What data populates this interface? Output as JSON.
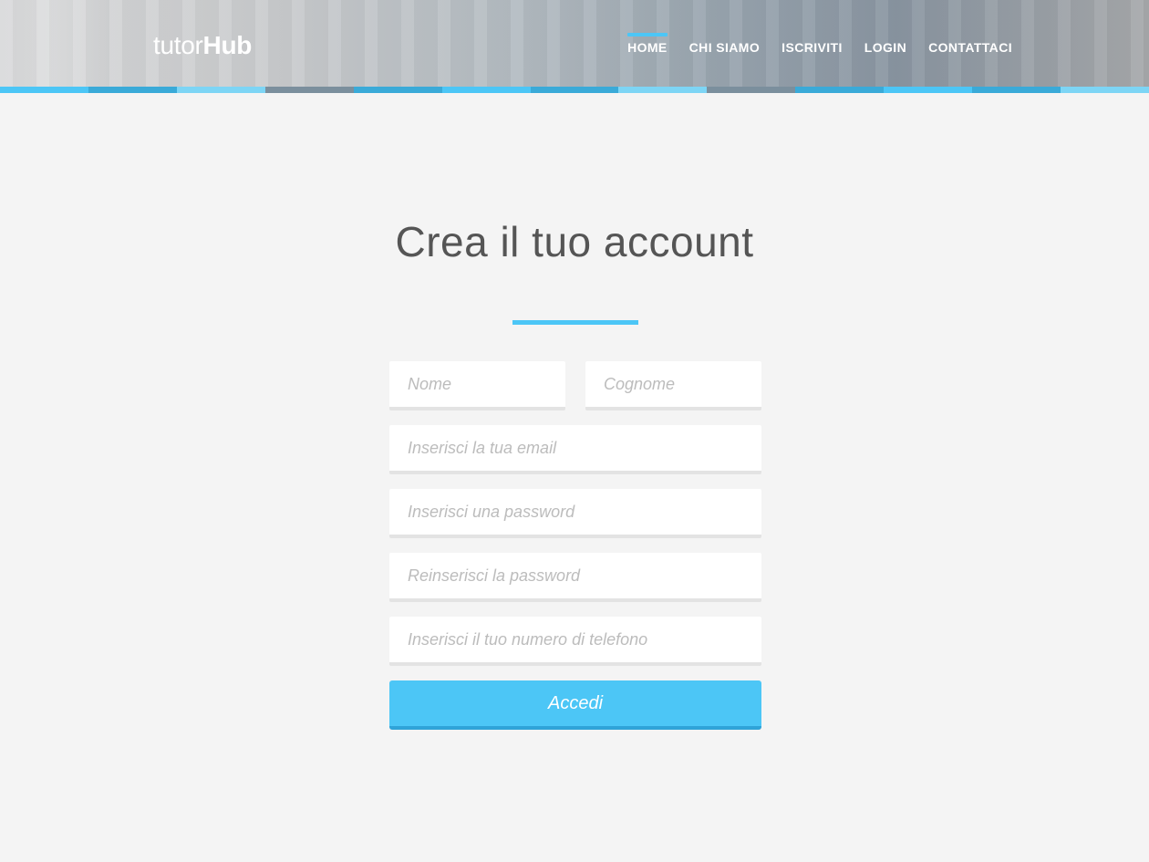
{
  "header": {
    "logo_light": "tutor",
    "logo_bold": "Hub",
    "nav": [
      {
        "label": "HOME",
        "active": true
      },
      {
        "label": "CHI SIAMO",
        "active": false
      },
      {
        "label": "ISCRIVITI",
        "active": false
      },
      {
        "label": "LOGIN",
        "active": false
      },
      {
        "label": "CONTATTACI",
        "active": false
      }
    ],
    "stripe_colors": [
      "#4cc6f6",
      "#3aaad8",
      "#7dd5f5",
      "#7b8f9d",
      "#3aaad8",
      "#4cc6f6",
      "#3aaad8",
      "#7dd5f5",
      "#7b8f9d",
      "#3aaad8",
      "#4cc6f6",
      "#3aaad8",
      "#7dd5f5"
    ]
  },
  "main": {
    "title": "Crea il tuo account"
  },
  "form": {
    "first_name_placeholder": "Nome",
    "last_name_placeholder": "Cognome",
    "email_placeholder": "Inserisci la tua email",
    "password_placeholder": "Inserisci una password",
    "confirm_password_placeholder": "Reinserisci la password",
    "phone_placeholder": "Inserisci il tuo numero di telefono",
    "submit_label": "Accedi"
  },
  "colors": {
    "accent": "#4cc6f6",
    "background": "#f4f4f4",
    "title_text": "#555555"
  }
}
